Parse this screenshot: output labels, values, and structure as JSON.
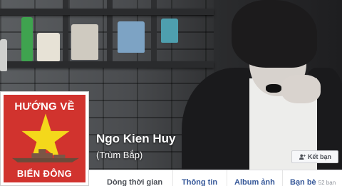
{
  "profile": {
    "name": "Ngo Kien Huy",
    "nickname": "(Trùm Bắp)"
  },
  "profile_picture": {
    "top_text": "HƯỚNG VỀ",
    "bottom_text": "BIỂN ĐÔNG",
    "colors": {
      "background": "#d1332e",
      "star": "#f4d81b"
    }
  },
  "actions": {
    "add_friend_label": "Kết bạn"
  },
  "tabs": [
    {
      "label": "Dòng thời gian"
    },
    {
      "label": "Thông tin"
    },
    {
      "label": "Album ảnh"
    },
    {
      "label": "Bạn bè",
      "count": "52 bạn"
    }
  ],
  "colors": {
    "link": "#365899",
    "tab_bg": "#ffffff",
    "page_bg": "#e9ebee"
  }
}
